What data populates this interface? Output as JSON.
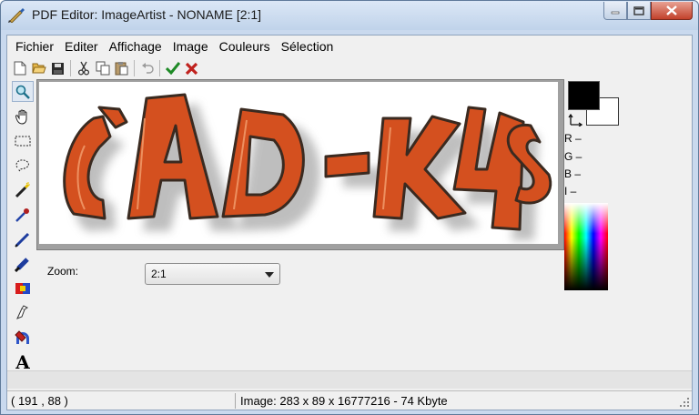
{
  "window": {
    "title": "PDF Editor: ImageArtist - NONAME [2:1]",
    "controls": {
      "minimize": "minimize-icon",
      "maximize": "maximize-icon",
      "close": "close-icon"
    }
  },
  "menu": [
    "Fichier",
    "Editer",
    "Affichage",
    "Image",
    "Couleurs",
    "Sélection"
  ],
  "toolbar": [
    "new-file-icon",
    "open-folder-icon",
    "save-icon",
    "cut-icon",
    "copy-icon",
    "paste-icon",
    "undo-icon",
    "ok-check-icon",
    "cancel-x-icon"
  ],
  "tools": [
    "zoom-icon",
    "hand-icon",
    "rect-select-icon",
    "lasso-icon",
    "magic-wand-icon",
    "eyedropper-icon",
    "pencil-icon",
    "brush-icon",
    "color-replace-icon",
    "eraser-icon",
    "fill-icon",
    "text-icon"
  ],
  "tools_text_glyph": "A",
  "canvas": {
    "image_text": "CAD-K4S"
  },
  "zoom": {
    "label": "Zoom:",
    "value": "2:1"
  },
  "color": {
    "foreground": "#000000",
    "background": "#ffffff",
    "r": "R –",
    "g": "G –",
    "b": "B –",
    "i": "I –"
  },
  "status": {
    "coords": "( 191 , 88 )",
    "info": "Image: 283 x 89 x 16777216 - 74 Kbyte"
  },
  "colors": {
    "accent_logo": "#d4501f",
    "title_bar": "#c9d9ee",
    "close_btn": "#c2412b"
  }
}
